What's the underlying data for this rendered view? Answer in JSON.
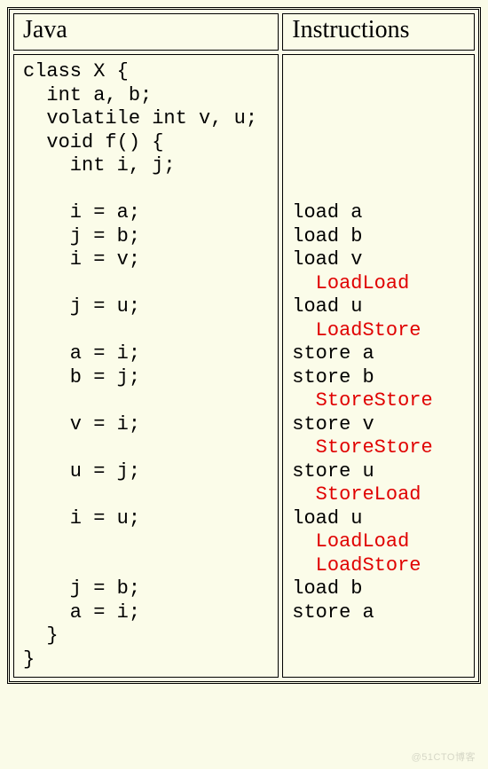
{
  "headers": {
    "java": "Java",
    "instructions": "Instructions"
  },
  "java_code": [
    "class X {",
    "  int a, b;",
    "  volatile int v, u;",
    "  void f() {",
    "    int i, j;",
    "",
    "    i = a;",
    "    j = b;",
    "    i = v;",
    "",
    "    j = u;",
    "",
    "    a = i;",
    "    b = j;",
    "",
    "    v = i;",
    "",
    "    u = j;",
    "",
    "    i = u;",
    "",
    "",
    "    j = b;",
    "    a = i;",
    "  }",
    "}"
  ],
  "instructions": [
    {
      "text": "",
      "barrier": false
    },
    {
      "text": "",
      "barrier": false
    },
    {
      "text": "",
      "barrier": false
    },
    {
      "text": "",
      "barrier": false
    },
    {
      "text": "",
      "barrier": false
    },
    {
      "text": "",
      "barrier": false
    },
    {
      "text": "load a",
      "barrier": false
    },
    {
      "text": "load b",
      "barrier": false
    },
    {
      "text": "load v",
      "barrier": false
    },
    {
      "text": "  LoadLoad",
      "barrier": true
    },
    {
      "text": "load u",
      "barrier": false
    },
    {
      "text": "  LoadStore",
      "barrier": true
    },
    {
      "text": "store a",
      "barrier": false
    },
    {
      "text": "store b",
      "barrier": false
    },
    {
      "text": "  StoreStore",
      "barrier": true
    },
    {
      "text": "store v",
      "barrier": false
    },
    {
      "text": "  StoreStore",
      "barrier": true
    },
    {
      "text": "store u",
      "barrier": false
    },
    {
      "text": "  StoreLoad",
      "barrier": true
    },
    {
      "text": "load u",
      "barrier": false
    },
    {
      "text": "  LoadLoad",
      "barrier": true
    },
    {
      "text": "  LoadStore",
      "barrier": true
    },
    {
      "text": "load b",
      "barrier": false
    },
    {
      "text": "store a",
      "barrier": false
    },
    {
      "text": "",
      "barrier": false
    },
    {
      "text": "",
      "barrier": false
    }
  ],
  "watermark": "@51CTO博客"
}
